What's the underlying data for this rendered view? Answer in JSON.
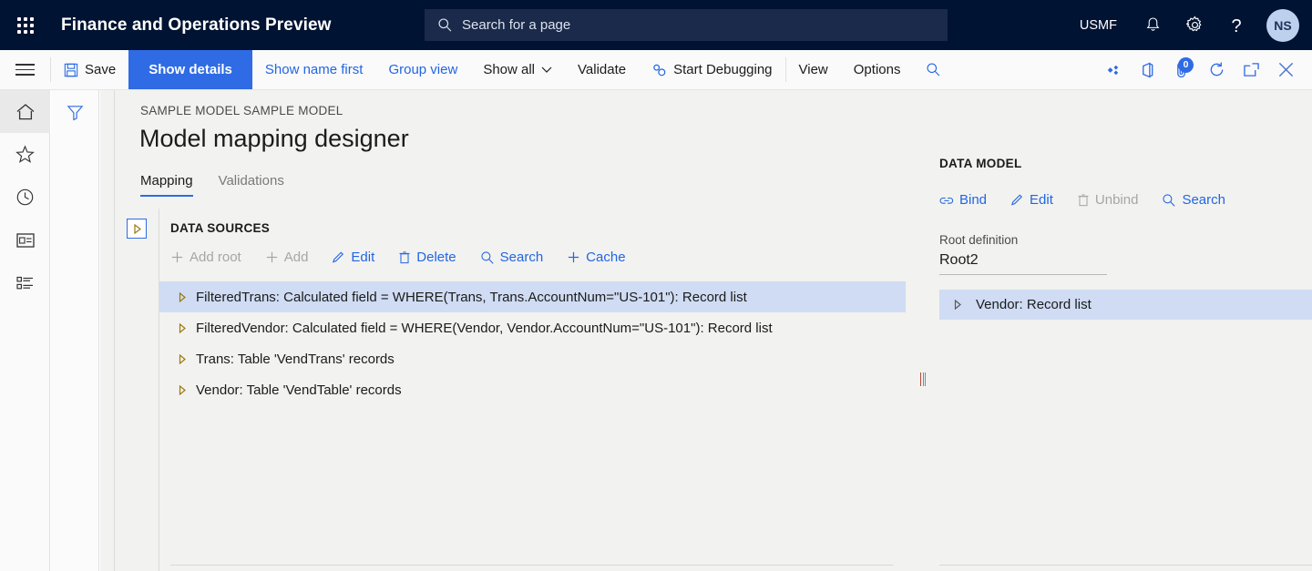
{
  "topbar": {
    "waffle_label": "app-launcher",
    "app_title": "Finance and Operations Preview",
    "search_placeholder": "Search for a page",
    "company": "USMF",
    "icons": [
      "notifications-bell-icon",
      "settings-gear-icon",
      "help-question-icon"
    ],
    "avatar_initials": "NS"
  },
  "commandbar": {
    "save": "Save",
    "show_details": "Show details",
    "show_name_first": "Show name first",
    "group_view": "Group view",
    "show_all": "Show all",
    "validate": "Validate",
    "start_debugging": "Start Debugging",
    "view": "View",
    "options": "Options",
    "notification_count": "0"
  },
  "rail": {
    "items": [
      {
        "name": "home-icon",
        "selected": true
      },
      {
        "name": "favorites-star-icon",
        "selected": false
      },
      {
        "name": "recent-clock-icon",
        "selected": false
      },
      {
        "name": "workspaces-icon",
        "selected": false
      },
      {
        "name": "modules-list-icon",
        "selected": false
      }
    ]
  },
  "filter_panel": {
    "icon": "filter-funnel-icon"
  },
  "page": {
    "breadcrumb": "SAMPLE MODEL SAMPLE MODEL",
    "title": "Model mapping designer",
    "tabs": [
      {
        "label": "Mapping",
        "selected": true
      },
      {
        "label": "Validations",
        "selected": false
      }
    ]
  },
  "data_sources": {
    "header": "DATA SOURCES",
    "expander_icon": "expand-right-triangle-icon",
    "tools": [
      {
        "label": "Add root",
        "icon": "plus-icon",
        "disabled": true
      },
      {
        "label": "Add",
        "icon": "plus-icon",
        "disabled": true
      },
      {
        "label": "Edit",
        "icon": "pencil-icon",
        "disabled": false
      },
      {
        "label": "Delete",
        "icon": "trash-icon",
        "disabled": false
      },
      {
        "label": "Search",
        "icon": "search-icon",
        "disabled": false
      },
      {
        "label": "Cache",
        "icon": "plus-icon",
        "disabled": false
      }
    ],
    "rows": [
      {
        "label": "FilteredTrans: Calculated field = WHERE(Trans, Trans.AccountNum=\"US-101\"): Record list",
        "selected": true
      },
      {
        "label": "FilteredVendor: Calculated field = WHERE(Vendor, Vendor.AccountNum=\"US-101\"): Record list",
        "selected": false
      },
      {
        "label": "Trans: Table 'VendTrans' records",
        "selected": false
      },
      {
        "label": "Vendor: Table 'VendTable' records",
        "selected": false
      }
    ]
  },
  "data_model": {
    "header": "DATA MODEL",
    "tools": [
      {
        "label": "Bind",
        "icon": "link-icon",
        "disabled": false
      },
      {
        "label": "Edit",
        "icon": "pencil-icon",
        "disabled": false
      },
      {
        "label": "Unbind",
        "icon": "trash-icon",
        "disabled": true
      },
      {
        "label": "Search",
        "icon": "search-icon",
        "disabled": false
      }
    ],
    "root_definition_label": "Root definition",
    "root_definition_value": "Root2",
    "rows": [
      {
        "label": "Vendor: Record list",
        "selected": true
      }
    ]
  },
  "colors": {
    "nav_bg": "#001332",
    "accent_blue": "#2F6BE4",
    "link_blue": "#2266E3",
    "selection_blue": "#cfdcf3",
    "page_bg": "#f2f2f0"
  }
}
